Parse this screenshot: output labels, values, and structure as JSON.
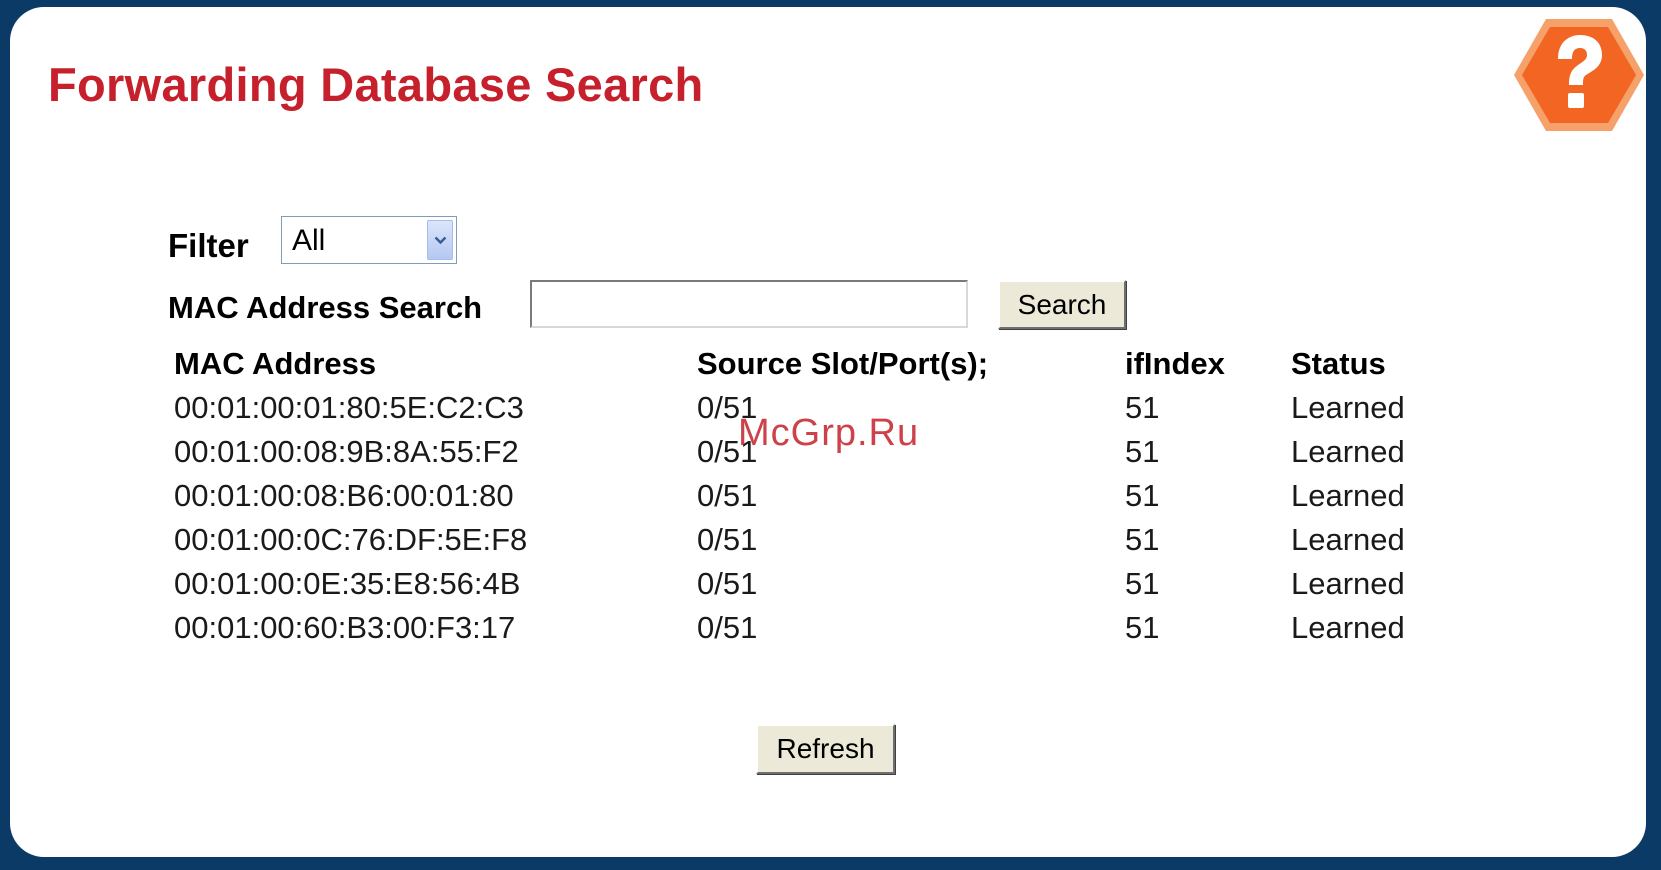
{
  "page": {
    "title": "Forwarding Database Search"
  },
  "help": {
    "icon": "help-question-icon",
    "color": "#f26522"
  },
  "filter": {
    "label": "Filter",
    "selected": "All"
  },
  "search": {
    "label": "MAC Address Search",
    "value": "",
    "button_label": "Search"
  },
  "table": {
    "headers": {
      "mac": "MAC Address",
      "port": "Source Slot/Port(s);",
      "ifindex": "ifIndex",
      "status": "Status"
    },
    "rows": [
      {
        "mac": "00:01:00:01:80:5E:C2:C3",
        "port": "0/51",
        "ifindex": "51",
        "status": "Learned"
      },
      {
        "mac": "00:01:00:08:9B:8A:55:F2",
        "port": "0/51",
        "ifindex": "51",
        "status": "Learned"
      },
      {
        "mac": "00:01:00:08:B6:00:01:80",
        "port": "0/51",
        "ifindex": "51",
        "status": "Learned"
      },
      {
        "mac": "00:01:00:0C:76:DF:5E:F8",
        "port": "0/51",
        "ifindex": "51",
        "status": "Learned"
      },
      {
        "mac": "00:01:00:0E:35:E8:56:4B",
        "port": "0/51",
        "ifindex": "51",
        "status": "Learned"
      },
      {
        "mac": "00:01:00:60:B3:00:F3:17",
        "port": "0/51",
        "ifindex": "51",
        "status": "Learned"
      }
    ]
  },
  "actions": {
    "refresh_label": "Refresh"
  },
  "watermark": "McGrp.Ru"
}
